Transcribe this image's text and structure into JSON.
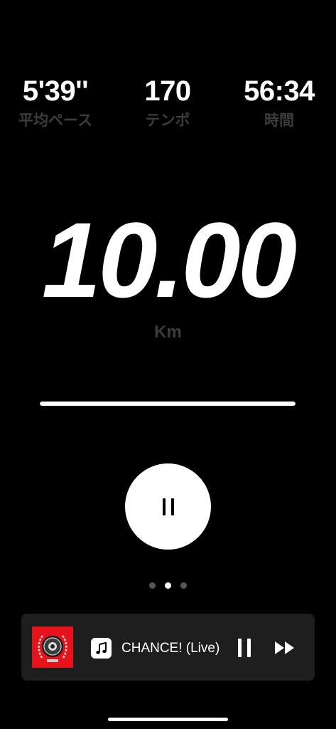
{
  "stats": {
    "pace": {
      "value": "5'39''",
      "label": "平均ペース"
    },
    "cadence": {
      "value": "170",
      "label": "テンポ"
    },
    "time": {
      "value": "56:34",
      "label": "時間"
    }
  },
  "distance": {
    "value": "10.00",
    "unit": "Km",
    "progress": 1.0
  },
  "controls": {
    "pause_icon": "pause-icon"
  },
  "pager": {
    "count": 3,
    "active_index": 1
  },
  "now_playing": {
    "app_icon": "music-note-icon",
    "track": "CHANCE! (Live)",
    "artwork_color": "#e8121b",
    "pause_icon": "pause-icon",
    "forward_icon": "fast-forward-icon"
  },
  "colors": {
    "background": "#000000",
    "label_gray": "#3c3c3c",
    "card": "#1e1e1e"
  }
}
